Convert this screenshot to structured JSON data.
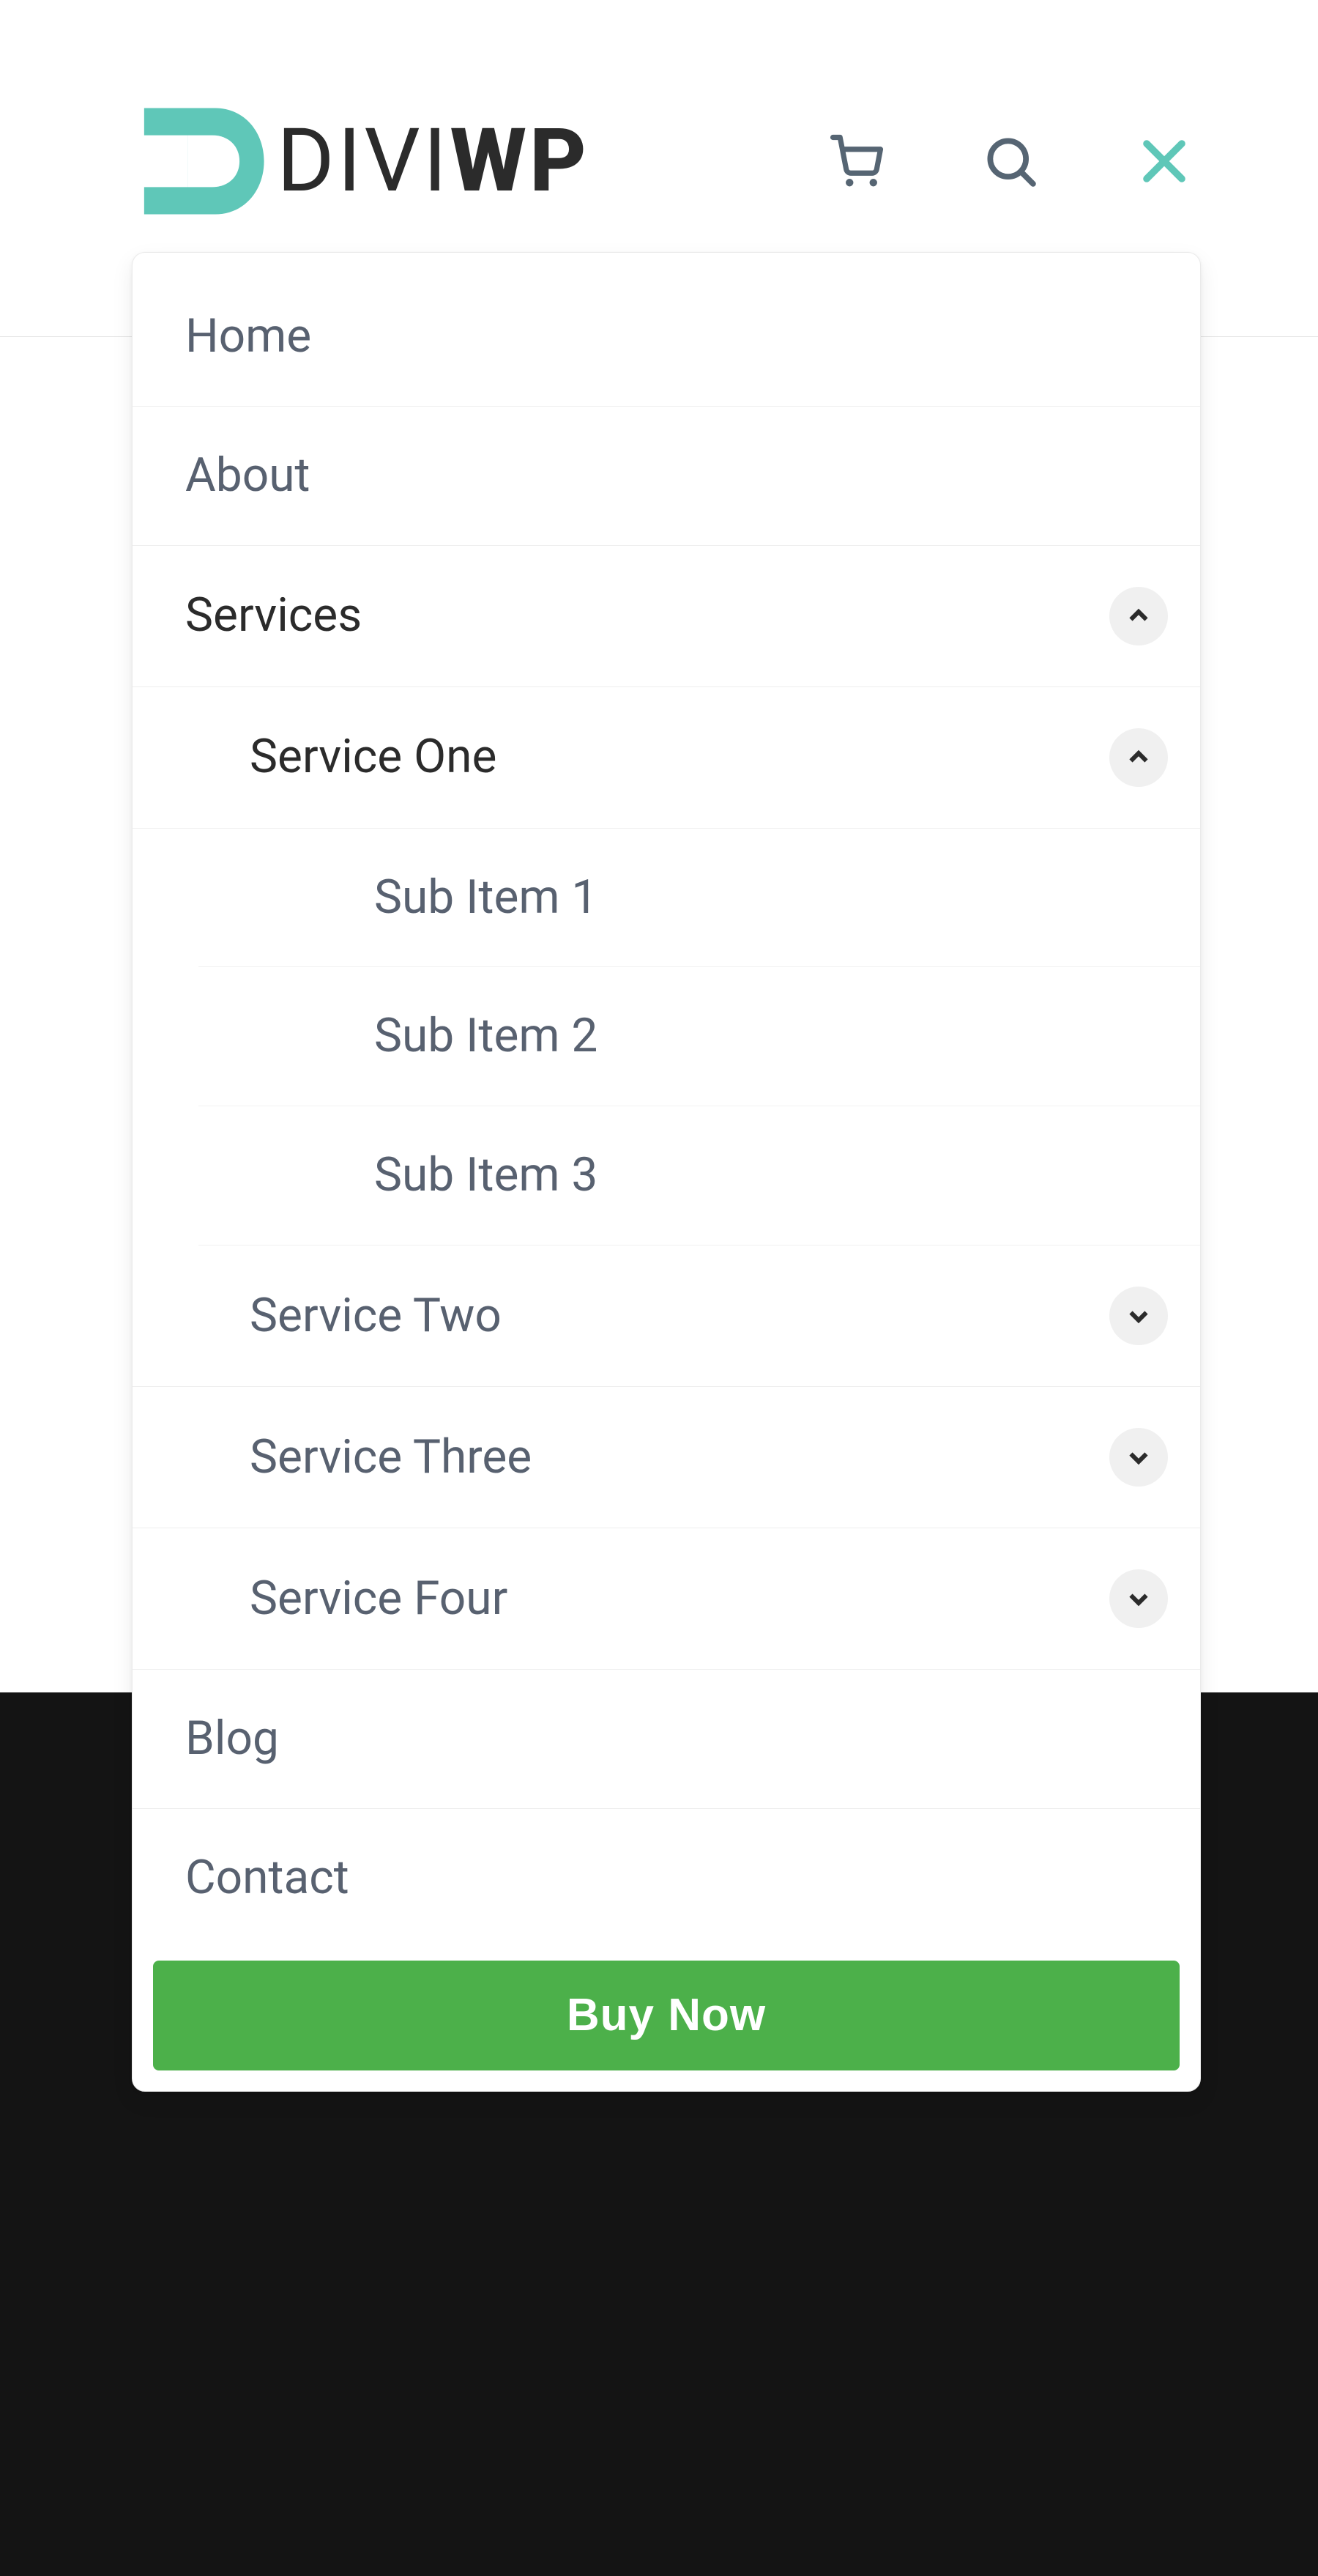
{
  "brand": {
    "logo_text_left": "DIVI",
    "logo_text_right": "WP",
    "logo_color": "#5fc7b8"
  },
  "header_icons": {
    "cart": "cart-icon",
    "search": "search-icon",
    "close": "close-icon"
  },
  "menu": {
    "items": [
      {
        "label": "Home",
        "active": false,
        "has_children": false
      },
      {
        "label": "About",
        "active": false,
        "has_children": false
      },
      {
        "label": "Services",
        "active": true,
        "has_children": true,
        "expanded": true
      },
      {
        "label": "Blog",
        "active": false,
        "has_children": false
      },
      {
        "label": "Contact",
        "active": false,
        "has_children": false
      }
    ],
    "services_children": [
      {
        "label": "Service One",
        "active": true,
        "has_children": true,
        "expanded": true
      },
      {
        "label": "Service Two",
        "active": false,
        "has_children": true,
        "expanded": false
      },
      {
        "label": "Service Three",
        "active": false,
        "has_children": true,
        "expanded": false
      },
      {
        "label": "Service Four",
        "active": false,
        "has_children": true,
        "expanded": false
      }
    ],
    "service_one_children": [
      {
        "label": "Sub Item 1"
      },
      {
        "label": "Sub Item 2"
      },
      {
        "label": "Sub Item 3"
      }
    ]
  },
  "cta": {
    "buy_label": "Buy Now"
  },
  "colors": {
    "accent_teal": "#5fc7b8",
    "cta_green": "#4cb04a",
    "text_muted": "#586170",
    "text_strong": "#2b2b2b",
    "dark_band": "#141414"
  }
}
